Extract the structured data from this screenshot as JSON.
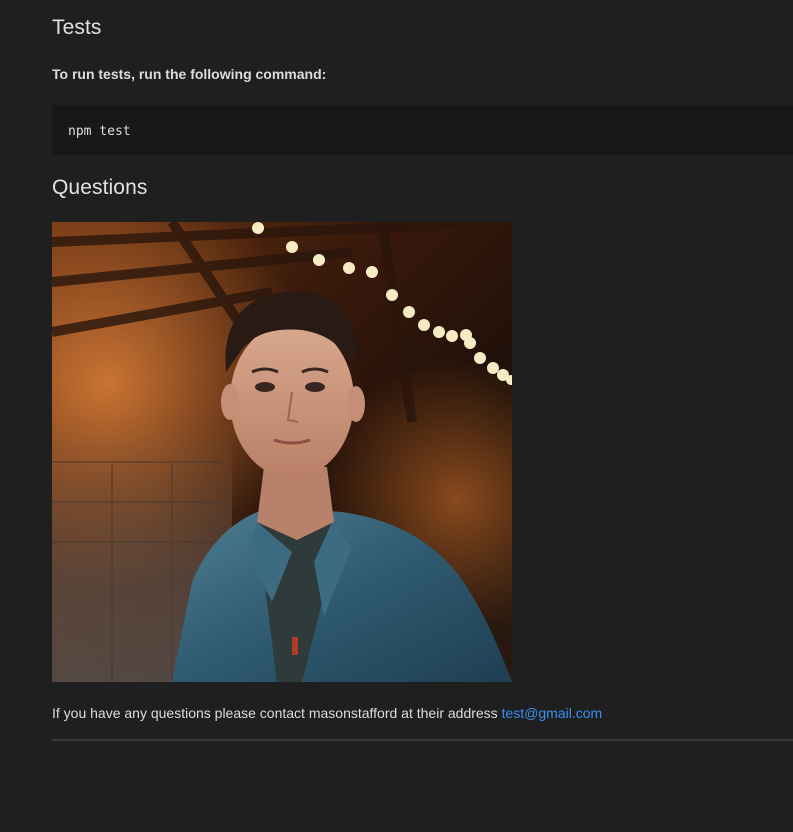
{
  "tests": {
    "heading": "Tests",
    "instruction": "To run tests, run the following command:",
    "command": "npm test"
  },
  "questions": {
    "heading": "Questions",
    "photo_alt": "profile photo",
    "contact_text": "If you have any questions please contact masonstafford at their address ",
    "email": "test@gmail.com"
  },
  "colors": {
    "background": "#1f1f1f",
    "code_background": "#181818",
    "link": "#3b8ef0"
  }
}
